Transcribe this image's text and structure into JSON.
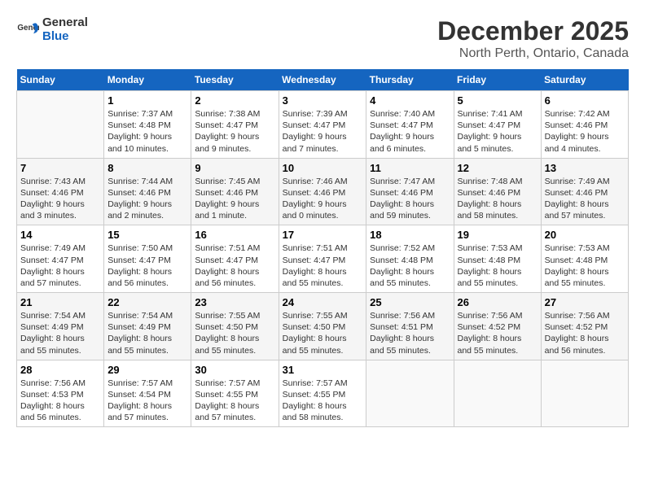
{
  "header": {
    "logo_general": "General",
    "logo_blue": "Blue",
    "month": "December 2025",
    "location": "North Perth, Ontario, Canada"
  },
  "weekdays": [
    "Sunday",
    "Monday",
    "Tuesday",
    "Wednesday",
    "Thursday",
    "Friday",
    "Saturday"
  ],
  "weeks": [
    [
      {
        "day": "",
        "info": ""
      },
      {
        "day": "1",
        "info": "Sunrise: 7:37 AM\nSunset: 4:48 PM\nDaylight: 9 hours\nand 10 minutes."
      },
      {
        "day": "2",
        "info": "Sunrise: 7:38 AM\nSunset: 4:47 PM\nDaylight: 9 hours\nand 9 minutes."
      },
      {
        "day": "3",
        "info": "Sunrise: 7:39 AM\nSunset: 4:47 PM\nDaylight: 9 hours\nand 7 minutes."
      },
      {
        "day": "4",
        "info": "Sunrise: 7:40 AM\nSunset: 4:47 PM\nDaylight: 9 hours\nand 6 minutes."
      },
      {
        "day": "5",
        "info": "Sunrise: 7:41 AM\nSunset: 4:47 PM\nDaylight: 9 hours\nand 5 minutes."
      },
      {
        "day": "6",
        "info": "Sunrise: 7:42 AM\nSunset: 4:46 PM\nDaylight: 9 hours\nand 4 minutes."
      }
    ],
    [
      {
        "day": "7",
        "info": "Sunrise: 7:43 AM\nSunset: 4:46 PM\nDaylight: 9 hours\nand 3 minutes."
      },
      {
        "day": "8",
        "info": "Sunrise: 7:44 AM\nSunset: 4:46 PM\nDaylight: 9 hours\nand 2 minutes."
      },
      {
        "day": "9",
        "info": "Sunrise: 7:45 AM\nSunset: 4:46 PM\nDaylight: 9 hours\nand 1 minute."
      },
      {
        "day": "10",
        "info": "Sunrise: 7:46 AM\nSunset: 4:46 PM\nDaylight: 9 hours\nand 0 minutes."
      },
      {
        "day": "11",
        "info": "Sunrise: 7:47 AM\nSunset: 4:46 PM\nDaylight: 8 hours\nand 59 minutes."
      },
      {
        "day": "12",
        "info": "Sunrise: 7:48 AM\nSunset: 4:46 PM\nDaylight: 8 hours\nand 58 minutes."
      },
      {
        "day": "13",
        "info": "Sunrise: 7:49 AM\nSunset: 4:46 PM\nDaylight: 8 hours\nand 57 minutes."
      }
    ],
    [
      {
        "day": "14",
        "info": "Sunrise: 7:49 AM\nSunset: 4:47 PM\nDaylight: 8 hours\nand 57 minutes."
      },
      {
        "day": "15",
        "info": "Sunrise: 7:50 AM\nSunset: 4:47 PM\nDaylight: 8 hours\nand 56 minutes."
      },
      {
        "day": "16",
        "info": "Sunrise: 7:51 AM\nSunset: 4:47 PM\nDaylight: 8 hours\nand 56 minutes."
      },
      {
        "day": "17",
        "info": "Sunrise: 7:51 AM\nSunset: 4:47 PM\nDaylight: 8 hours\nand 55 minutes."
      },
      {
        "day": "18",
        "info": "Sunrise: 7:52 AM\nSunset: 4:48 PM\nDaylight: 8 hours\nand 55 minutes."
      },
      {
        "day": "19",
        "info": "Sunrise: 7:53 AM\nSunset: 4:48 PM\nDaylight: 8 hours\nand 55 minutes."
      },
      {
        "day": "20",
        "info": "Sunrise: 7:53 AM\nSunset: 4:48 PM\nDaylight: 8 hours\nand 55 minutes."
      }
    ],
    [
      {
        "day": "21",
        "info": "Sunrise: 7:54 AM\nSunset: 4:49 PM\nDaylight: 8 hours\nand 55 minutes."
      },
      {
        "day": "22",
        "info": "Sunrise: 7:54 AM\nSunset: 4:49 PM\nDaylight: 8 hours\nand 55 minutes."
      },
      {
        "day": "23",
        "info": "Sunrise: 7:55 AM\nSunset: 4:50 PM\nDaylight: 8 hours\nand 55 minutes."
      },
      {
        "day": "24",
        "info": "Sunrise: 7:55 AM\nSunset: 4:50 PM\nDaylight: 8 hours\nand 55 minutes."
      },
      {
        "day": "25",
        "info": "Sunrise: 7:56 AM\nSunset: 4:51 PM\nDaylight: 8 hours\nand 55 minutes."
      },
      {
        "day": "26",
        "info": "Sunrise: 7:56 AM\nSunset: 4:52 PM\nDaylight: 8 hours\nand 55 minutes."
      },
      {
        "day": "27",
        "info": "Sunrise: 7:56 AM\nSunset: 4:52 PM\nDaylight: 8 hours\nand 56 minutes."
      }
    ],
    [
      {
        "day": "28",
        "info": "Sunrise: 7:56 AM\nSunset: 4:53 PM\nDaylight: 8 hours\nand 56 minutes."
      },
      {
        "day": "29",
        "info": "Sunrise: 7:57 AM\nSunset: 4:54 PM\nDaylight: 8 hours\nand 57 minutes."
      },
      {
        "day": "30",
        "info": "Sunrise: 7:57 AM\nSunset: 4:55 PM\nDaylight: 8 hours\nand 57 minutes."
      },
      {
        "day": "31",
        "info": "Sunrise: 7:57 AM\nSunset: 4:55 PM\nDaylight: 8 hours\nand 58 minutes."
      },
      {
        "day": "",
        "info": ""
      },
      {
        "day": "",
        "info": ""
      },
      {
        "day": "",
        "info": ""
      }
    ]
  ]
}
